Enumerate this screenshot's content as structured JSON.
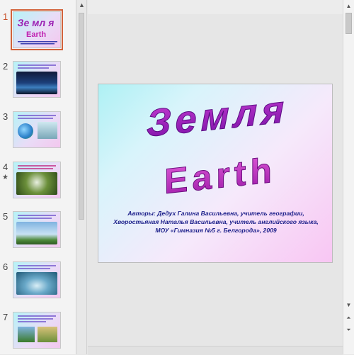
{
  "thumbnails": [
    {
      "number": "1",
      "selected": true
    },
    {
      "number": "2",
      "selected": false
    },
    {
      "number": "3",
      "selected": false
    },
    {
      "number": "4",
      "selected": false,
      "star": "★"
    },
    {
      "number": "5",
      "selected": false
    },
    {
      "number": "6",
      "selected": false
    },
    {
      "number": "7",
      "selected": false
    }
  ],
  "scroll": {
    "up": "▲",
    "down": "▼",
    "prev": "⏶",
    "next": "⏷"
  },
  "slide": {
    "title_ru": "Земля",
    "title_en": "Earth",
    "authors_line1": "Авторы: Дедух Галина Васильевна, учитель географии,",
    "authors_line2": "Хворостьяная Наталья Васильевна, учитель английского языка,",
    "authors_line3": "МОУ «Гимназия №5 г. Белгорода», 2009"
  },
  "colors": {
    "accent": "#d2623a",
    "title": "#a020b0",
    "authors": "#1c1f8a"
  }
}
